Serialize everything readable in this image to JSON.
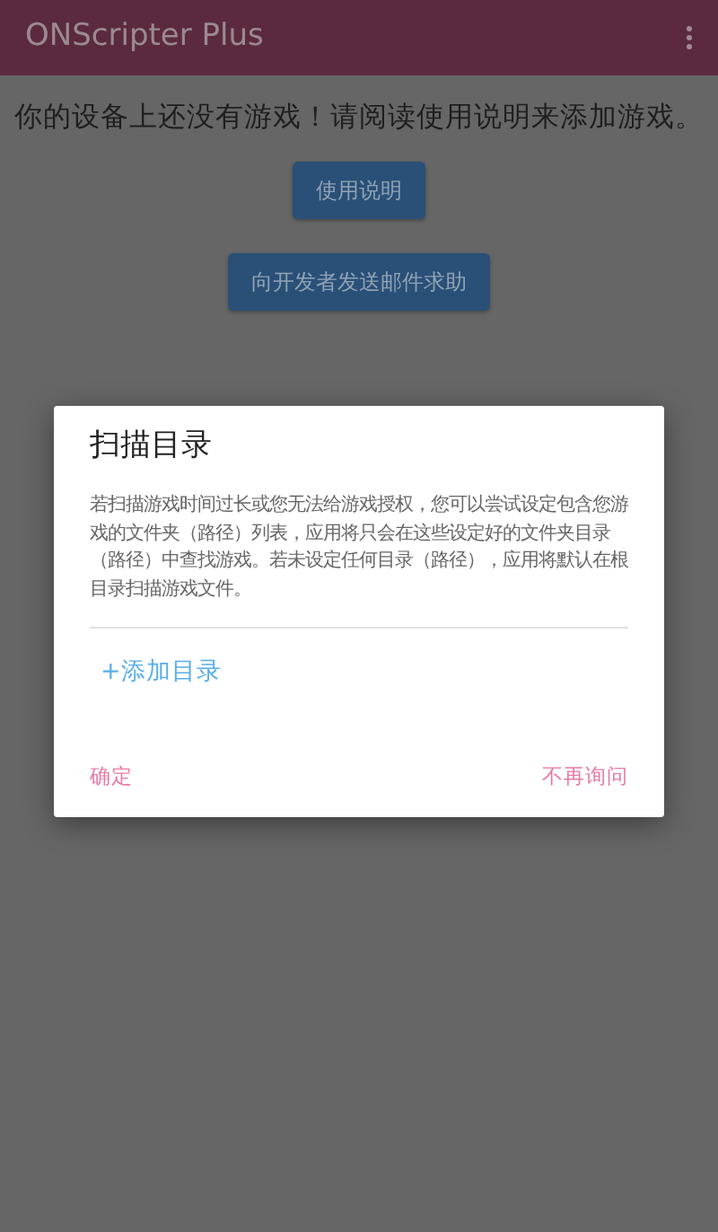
{
  "app_bar": {
    "title": "ONScripter Plus"
  },
  "message": "你的设备上还没有游戏！请阅读使用说明来添加游戏。",
  "buttons": [
    "使用说明",
    "向开发者发送邮件求助"
  ],
  "dialog": {
    "title": "扫描目录",
    "body": "若扫描游戏时间过长或您无法给游戏授权，您可以尝试设定包含您游戏的文件夹（路径）列表，应用将只会在这些设定好的文件夹目录（路径）中查找游戏。若未设定任何目录（路径），应用将默认在根目录扫描游戏文件。",
    "add_link": "+添加目录",
    "actions": [
      "确定",
      "不再询问"
    ]
  }
}
